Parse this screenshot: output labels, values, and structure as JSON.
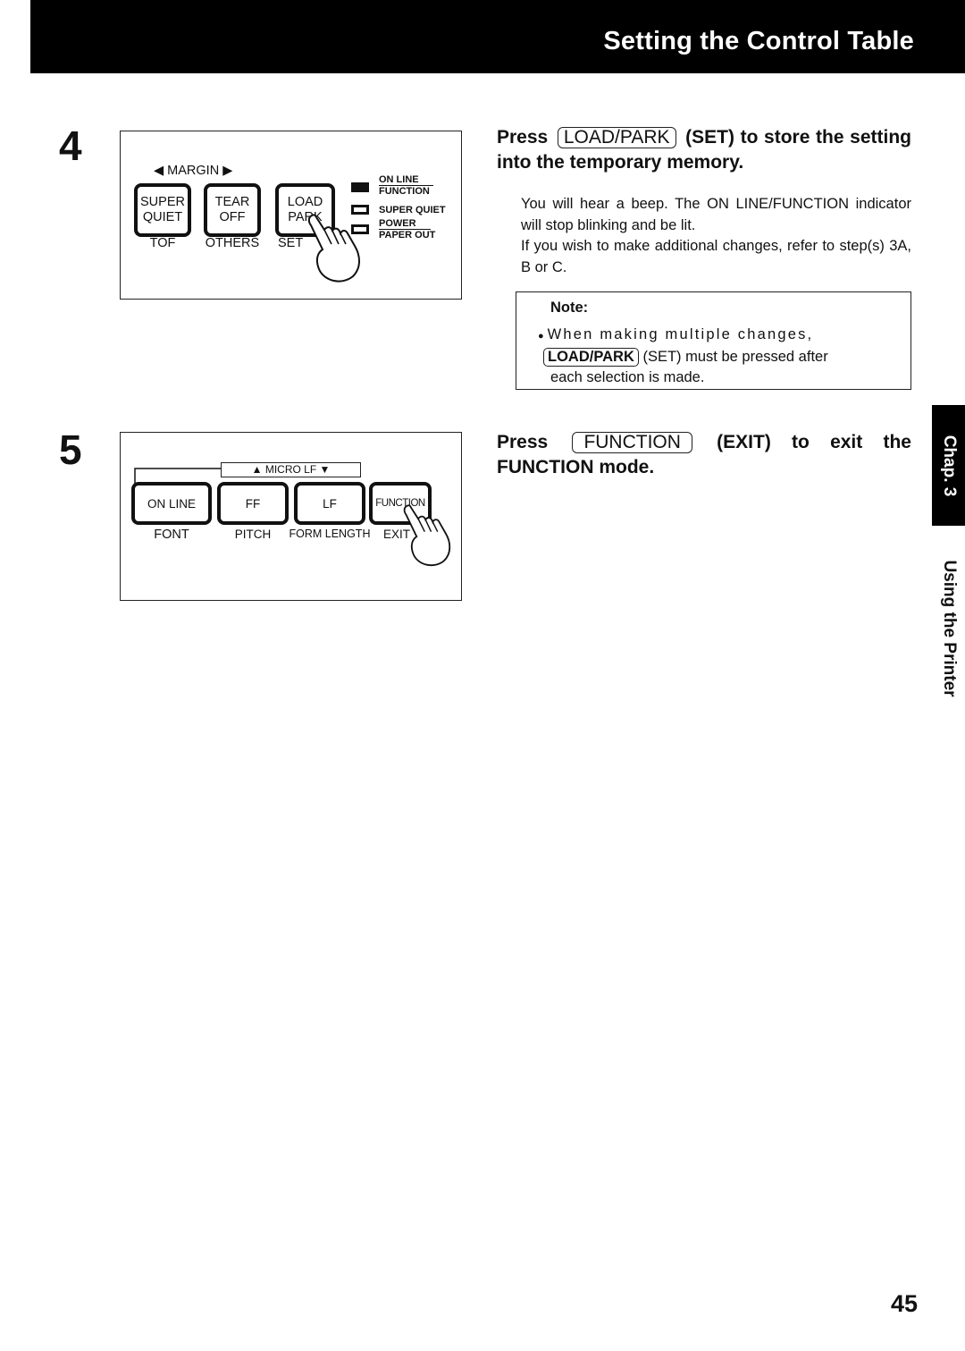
{
  "header": {
    "title": "Setting the Control Table"
  },
  "steps": [
    {
      "number": "4",
      "panel": {
        "margin_label": "◀ MARGIN ▶",
        "buttons": [
          {
            "top": "SUPER",
            "bottom": "QUIET",
            "below": "TOF"
          },
          {
            "top": "TEAR",
            "bottom": "OFF",
            "below": "OTHERS"
          },
          {
            "top": "LOAD",
            "bottom": "PARK",
            "below": "SET"
          }
        ],
        "indicators": [
          {
            "state": "lit",
            "top": "ON LINE",
            "bottom": "FUNCTION"
          },
          {
            "state": "off",
            "label": "SUPER QUIET"
          },
          {
            "state": "off",
            "top": "POWER",
            "bottom": "PAPER OUT"
          }
        ],
        "pressed_button": "LOAD PARK"
      },
      "instruction": {
        "prefix": "Press",
        "key": "LOAD/PARK",
        "suffix": "(SET) to store the setting into the temporary memory."
      },
      "body": [
        "You will hear a beep. The ON LINE/FUNCTION indicator will stop blinking and be lit.",
        "If you wish to make additional changes, refer to step(s) 3A, B or C."
      ],
      "note": {
        "title": "Note:",
        "bullet": "●",
        "line1": "When making multiple changes,",
        "key": "LOAD/PARK",
        "line2": "(SET) must be pressed after",
        "line3": "each selection is made."
      }
    },
    {
      "number": "5",
      "panel": {
        "microlf_label": "▲ MICRO LF ▼",
        "buttons": [
          {
            "label": "ON LINE",
            "below": "FONT"
          },
          {
            "label": "FF",
            "below": "PITCH"
          },
          {
            "label": "LF",
            "below": "FORM LENGTH"
          },
          {
            "label": "FUNCTION",
            "below": "EXIT"
          }
        ],
        "pressed_button": "FUNCTION"
      },
      "instruction": {
        "prefix": "Press",
        "key": "FUNCTION",
        "suffix": "(EXIT) to exit the FUNCTION mode."
      }
    }
  ],
  "side_tab": {
    "chapter": "Chap. 3",
    "section": "Using the Printer"
  },
  "page_number": "45"
}
